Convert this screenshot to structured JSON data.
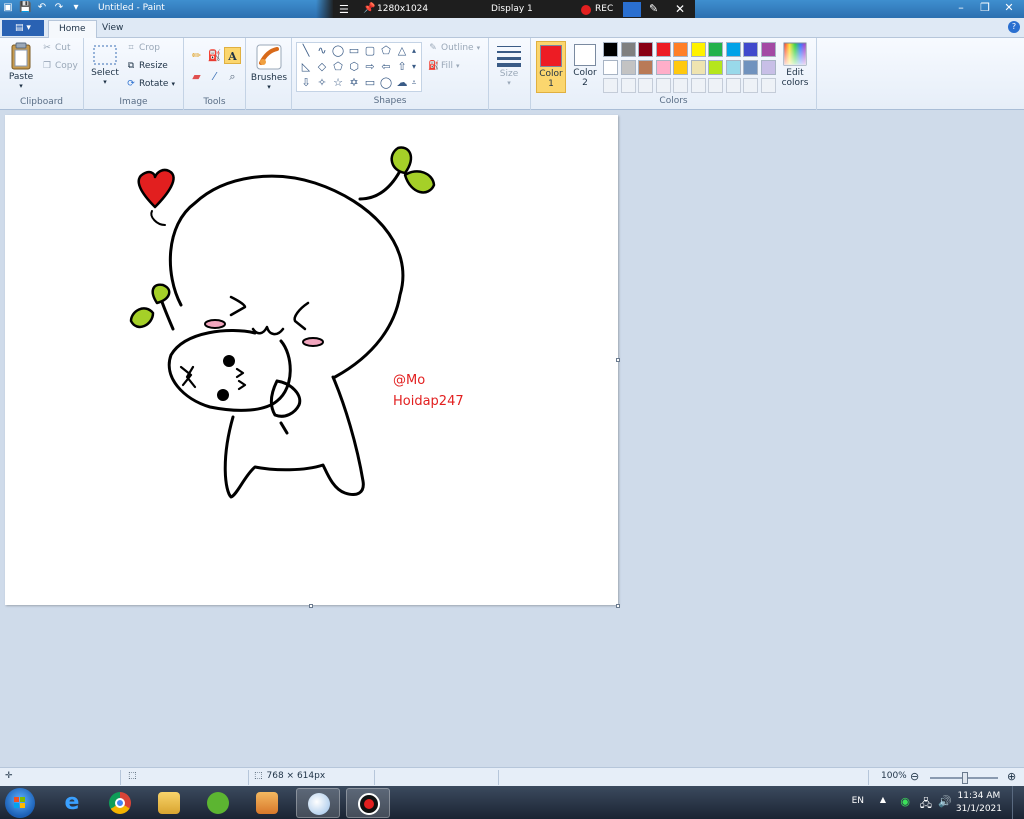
{
  "window": {
    "title": "Untitled - Paint",
    "controls": [
      "minimize",
      "restore",
      "close"
    ]
  },
  "recorder": {
    "resolution": "1280x1024",
    "display": "Display 1",
    "rec_label": "REC"
  },
  "tabs": {
    "file_label": "",
    "home": "Home",
    "view": "View"
  },
  "ribbon": {
    "clipboard": {
      "label": "Clipboard",
      "paste": "Paste",
      "cut": "Cut",
      "copy": "Copy"
    },
    "image": {
      "label": "Image",
      "select": "Select",
      "crop": "Crop",
      "resize": "Resize",
      "rotate": "Rotate"
    },
    "tools": {
      "label": "Tools"
    },
    "brushes": {
      "label": "Brushes"
    },
    "shapes": {
      "label": "Shapes",
      "outline": "Outline",
      "fill": "Fill"
    },
    "size": {
      "label": "Size"
    },
    "colors": {
      "label": "Colors",
      "color1": "Color\n1",
      "color1_label": "Color",
      "color1_num": "1",
      "color2_label": "Color",
      "color2_num": "2",
      "edit": "Edit",
      "edit2": "colors",
      "color1_value": "#ed1c24",
      "color2_value": "#ffffff",
      "palette": [
        "#000000",
        "#7f7f7f",
        "#880015",
        "#ed1c24",
        "#ff7f27",
        "#fff200",
        "#22b14c",
        "#00a2e8",
        "#3f48cc",
        "#a349a4",
        "#ffffff",
        "#c3c3c3",
        "#b97a57",
        "#ffaec9",
        "#ffc90e",
        "#efe4b0",
        "#b5e61d",
        "#99d9ea",
        "#7092be",
        "#c8bfe7"
      ]
    }
  },
  "canvas": {
    "watermark_line1": "@Mo",
    "watermark_line2": "Hoidap247"
  },
  "status": {
    "dimensions": "768 × 614px",
    "zoom": "100%"
  },
  "taskbar": {
    "language": "EN",
    "time": "11:34 AM",
    "date": "31/1/2021"
  }
}
